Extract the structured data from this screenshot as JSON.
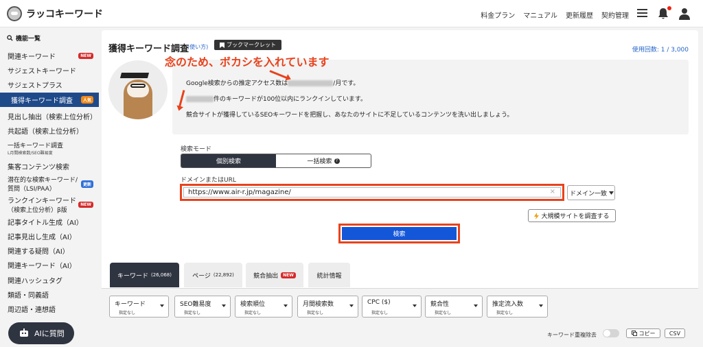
{
  "header": {
    "logo_text": "ラッコキーワード",
    "nav": [
      "料金プラン",
      "マニュアル",
      "更新履歴",
      "契約管理"
    ],
    "icons": [
      "menu-icon",
      "bell-icon",
      "user-icon"
    ]
  },
  "sidebar": {
    "heading": "機能一覧",
    "items": [
      {
        "label": "関連キーワード",
        "badge": "NEW"
      },
      {
        "label": "サジェストキーワード",
        "badge": ""
      },
      {
        "label": "サジェストプラス",
        "badge": ""
      },
      {
        "label": "獲得キーワード調査",
        "badge": "人気",
        "active": true
      },
      {
        "label": "見出し抽出（検索上位分析）",
        "badge": ""
      },
      {
        "label": "共起語（検索上位分析）",
        "badge": ""
      },
      {
        "label": "一括キーワード調査",
        "sub": "L月間検索数/SEO難易度",
        "badge": ""
      },
      {
        "label": "集客コンテンツ検索",
        "badge": ""
      },
      {
        "label": "潜在的な検索キーワード/",
        "label2": "質問（LSI/PAA）",
        "badge": "更新"
      },
      {
        "label": "ランクインキーワード",
        "label2": "（検索上位分析）β版",
        "badge": "NEW"
      },
      {
        "label": "記事タイトル生成（AI）",
        "badge": ""
      },
      {
        "label": "記事見出し生成（AI）",
        "badge": ""
      },
      {
        "label": "関連する疑問（AI）",
        "badge": ""
      },
      {
        "label": "関連キーワード（AI）",
        "badge": ""
      },
      {
        "label": "関連ハッシュタグ",
        "badge": ""
      },
      {
        "label": "類語・同義語",
        "badge": ""
      },
      {
        "label": "周辺語・連想語",
        "badge": ""
      }
    ],
    "ai_button": "AIに質問"
  },
  "main": {
    "title": "獲得キーワード調査",
    "howto": "(使い方)",
    "bookmarklet": "ブックマークレット",
    "usage": "使用回数: 1 / 3,000",
    "annotation": "念のため、ボカシを入れています",
    "info_line1_pre": "Google検索からの推定アクセス数は",
    "info_line1_post": "/月です。",
    "info_line2_post": "件のキーワードが100位以内にランクインしています。",
    "info_line3": "競合サイトが獲得しているSEOキーワードを把握し、あなたのサイトに不足しているコンテンツを洗い出しましょう。",
    "mode_label": "検索モード",
    "mode_single": "個別検索",
    "mode_bulk": "一括検索",
    "domain_label": "ドメインまたはURL",
    "url_value": "https://www.air-r.jp/magazine/",
    "match_select": "ドメイン一致",
    "large_site_button": "大規模サイトを調査する",
    "search_button": "検索"
  },
  "tabs": [
    {
      "label": "キーワード",
      "count": "(26,068)",
      "badge": ""
    },
    {
      "label": "ページ",
      "count": "(22,892)",
      "badge": ""
    },
    {
      "label": "競合抽出",
      "count": "",
      "badge": "NEW"
    },
    {
      "label": "統計情報",
      "count": "",
      "badge": ""
    }
  ],
  "filters": [
    {
      "label": "キーワード",
      "value": "指定なし"
    },
    {
      "label": "SEO難易度",
      "value": "指定なし"
    },
    {
      "label": "検索順位",
      "value": "指定なし"
    },
    {
      "label": "月間検索数",
      "value": "指定なし"
    },
    {
      "label": "CPC ($)",
      "value": "指定なし"
    },
    {
      "label": "競合性",
      "value": "指定なし"
    },
    {
      "label": "推定流入数",
      "value": "指定なし"
    }
  ],
  "toolbar": {
    "dup_remove": "キーワード重複除去",
    "copy": "コピー",
    "csv": "CSV"
  },
  "colors": {
    "accent_red": "#e8421c",
    "primary_blue": "#1456d8",
    "sidebar_active": "#1f4a8a"
  }
}
